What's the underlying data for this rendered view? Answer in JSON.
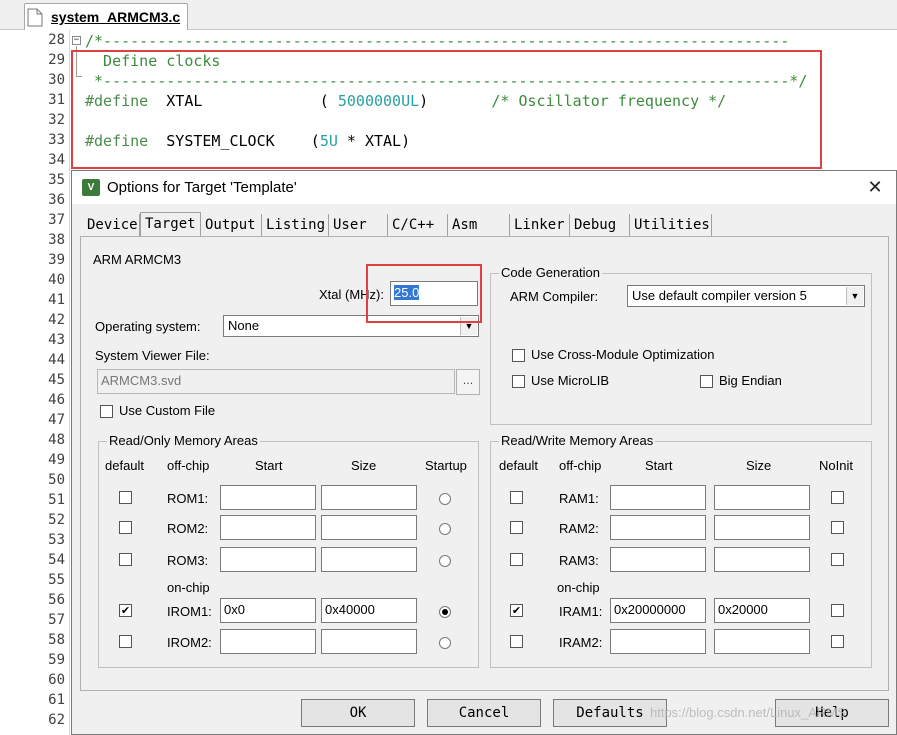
{
  "editor": {
    "tab_label": "system_ARMCM3.c",
    "line_numbers": [
      "28",
      "29",
      "30",
      "31",
      "32",
      "33",
      "34",
      "35",
      "36",
      "37",
      "38",
      "39",
      "40",
      "41",
      "42",
      "43",
      "44",
      "45",
      "46",
      "47",
      "48",
      "49",
      "50",
      "51",
      "52",
      "53",
      "54",
      "55",
      "56",
      "57",
      "58",
      "59",
      "60",
      "61",
      "62"
    ],
    "code": {
      "line28": "/*----------------------------------------------------------------------------",
      "line29": "  Define clocks",
      "line30": " *----------------------------------------------------------------------------*/",
      "line31_pp": "#define",
      "line31_name": "  XTAL             ( ",
      "line31_num": "5000000UL",
      "line31_close": ")       ",
      "line31_comment": "/* Oscillator frequency */",
      "line33_pp": "#define",
      "line33_name": "  SYSTEM_CLOCK    (",
      "line33_num": "5U",
      "line33_rest": " * XTAL)"
    }
  },
  "dialog": {
    "title": "Options for Target 'Template'",
    "tabs": [
      "Device",
      "Target",
      "Output",
      "Listing",
      "User",
      "C/C++",
      "Asm",
      "Linker",
      "Debug",
      "Utilities"
    ],
    "active_tab": "Target",
    "device_label": "ARM ARMCM3",
    "xtal_label": "Xtal (MHz):",
    "xtal_value": "25.0",
    "os_label": "Operating system:",
    "os_value": "None",
    "svd_label": "System Viewer File:",
    "svd_value": "ARMCM3.svd",
    "browse_label": "...",
    "use_custom_file": "Use Custom File",
    "code_gen": {
      "title": "Code Generation",
      "compiler_label": "ARM Compiler:",
      "compiler_value": "Use default compiler version 5",
      "cross_module": "Use Cross-Module Optimization",
      "microlib": "Use MicroLIB",
      "big_endian": "Big Endian"
    },
    "ro_memory": {
      "title": "Read/Only Memory Areas",
      "headers": {
        "default": "default",
        "offchip": "off-chip",
        "start": "Start",
        "size": "Size",
        "startup": "Startup"
      },
      "onchip_label": "on-chip",
      "rows": [
        {
          "name": "ROM1:",
          "start": "",
          "size": "",
          "default": false,
          "startup": false
        },
        {
          "name": "ROM2:",
          "start": "",
          "size": "",
          "default": false,
          "startup": false
        },
        {
          "name": "ROM3:",
          "start": "",
          "size": "",
          "default": false,
          "startup": false
        },
        {
          "name": "IROM1:",
          "start": "0x0",
          "size": "0x40000",
          "default": true,
          "startup": true
        },
        {
          "name": "IROM2:",
          "start": "",
          "size": "",
          "default": false,
          "startup": false
        }
      ]
    },
    "rw_memory": {
      "title": "Read/Write Memory Areas",
      "headers": {
        "default": "default",
        "offchip": "off-chip",
        "start": "Start",
        "size": "Size",
        "noinit": "NoInit"
      },
      "onchip_label": "on-chip",
      "rows": [
        {
          "name": "RAM1:",
          "start": "",
          "size": "",
          "default": false,
          "noinit": false
        },
        {
          "name": "RAM2:",
          "start": "",
          "size": "",
          "default": false,
          "noinit": false
        },
        {
          "name": "RAM3:",
          "start": "",
          "size": "",
          "default": false,
          "noinit": false
        },
        {
          "name": "IRAM1:",
          "start": "0x20000000",
          "size": "0x20000",
          "default": true,
          "noinit": false
        },
        {
          "name": "IRAM2:",
          "start": "",
          "size": "",
          "default": false,
          "noinit": false
        }
      ]
    },
    "buttons": {
      "ok": "OK",
      "cancel": "Cancel",
      "defaults": "Defaults",
      "help": "Help"
    }
  },
  "watermark": "https://blog.csdn.net/Linux_ARMS",
  "colors": {
    "highlight_box": "#e04040",
    "selection": "#3478d4",
    "comment": "#3c8c3c",
    "number": "#2aa0a0"
  }
}
